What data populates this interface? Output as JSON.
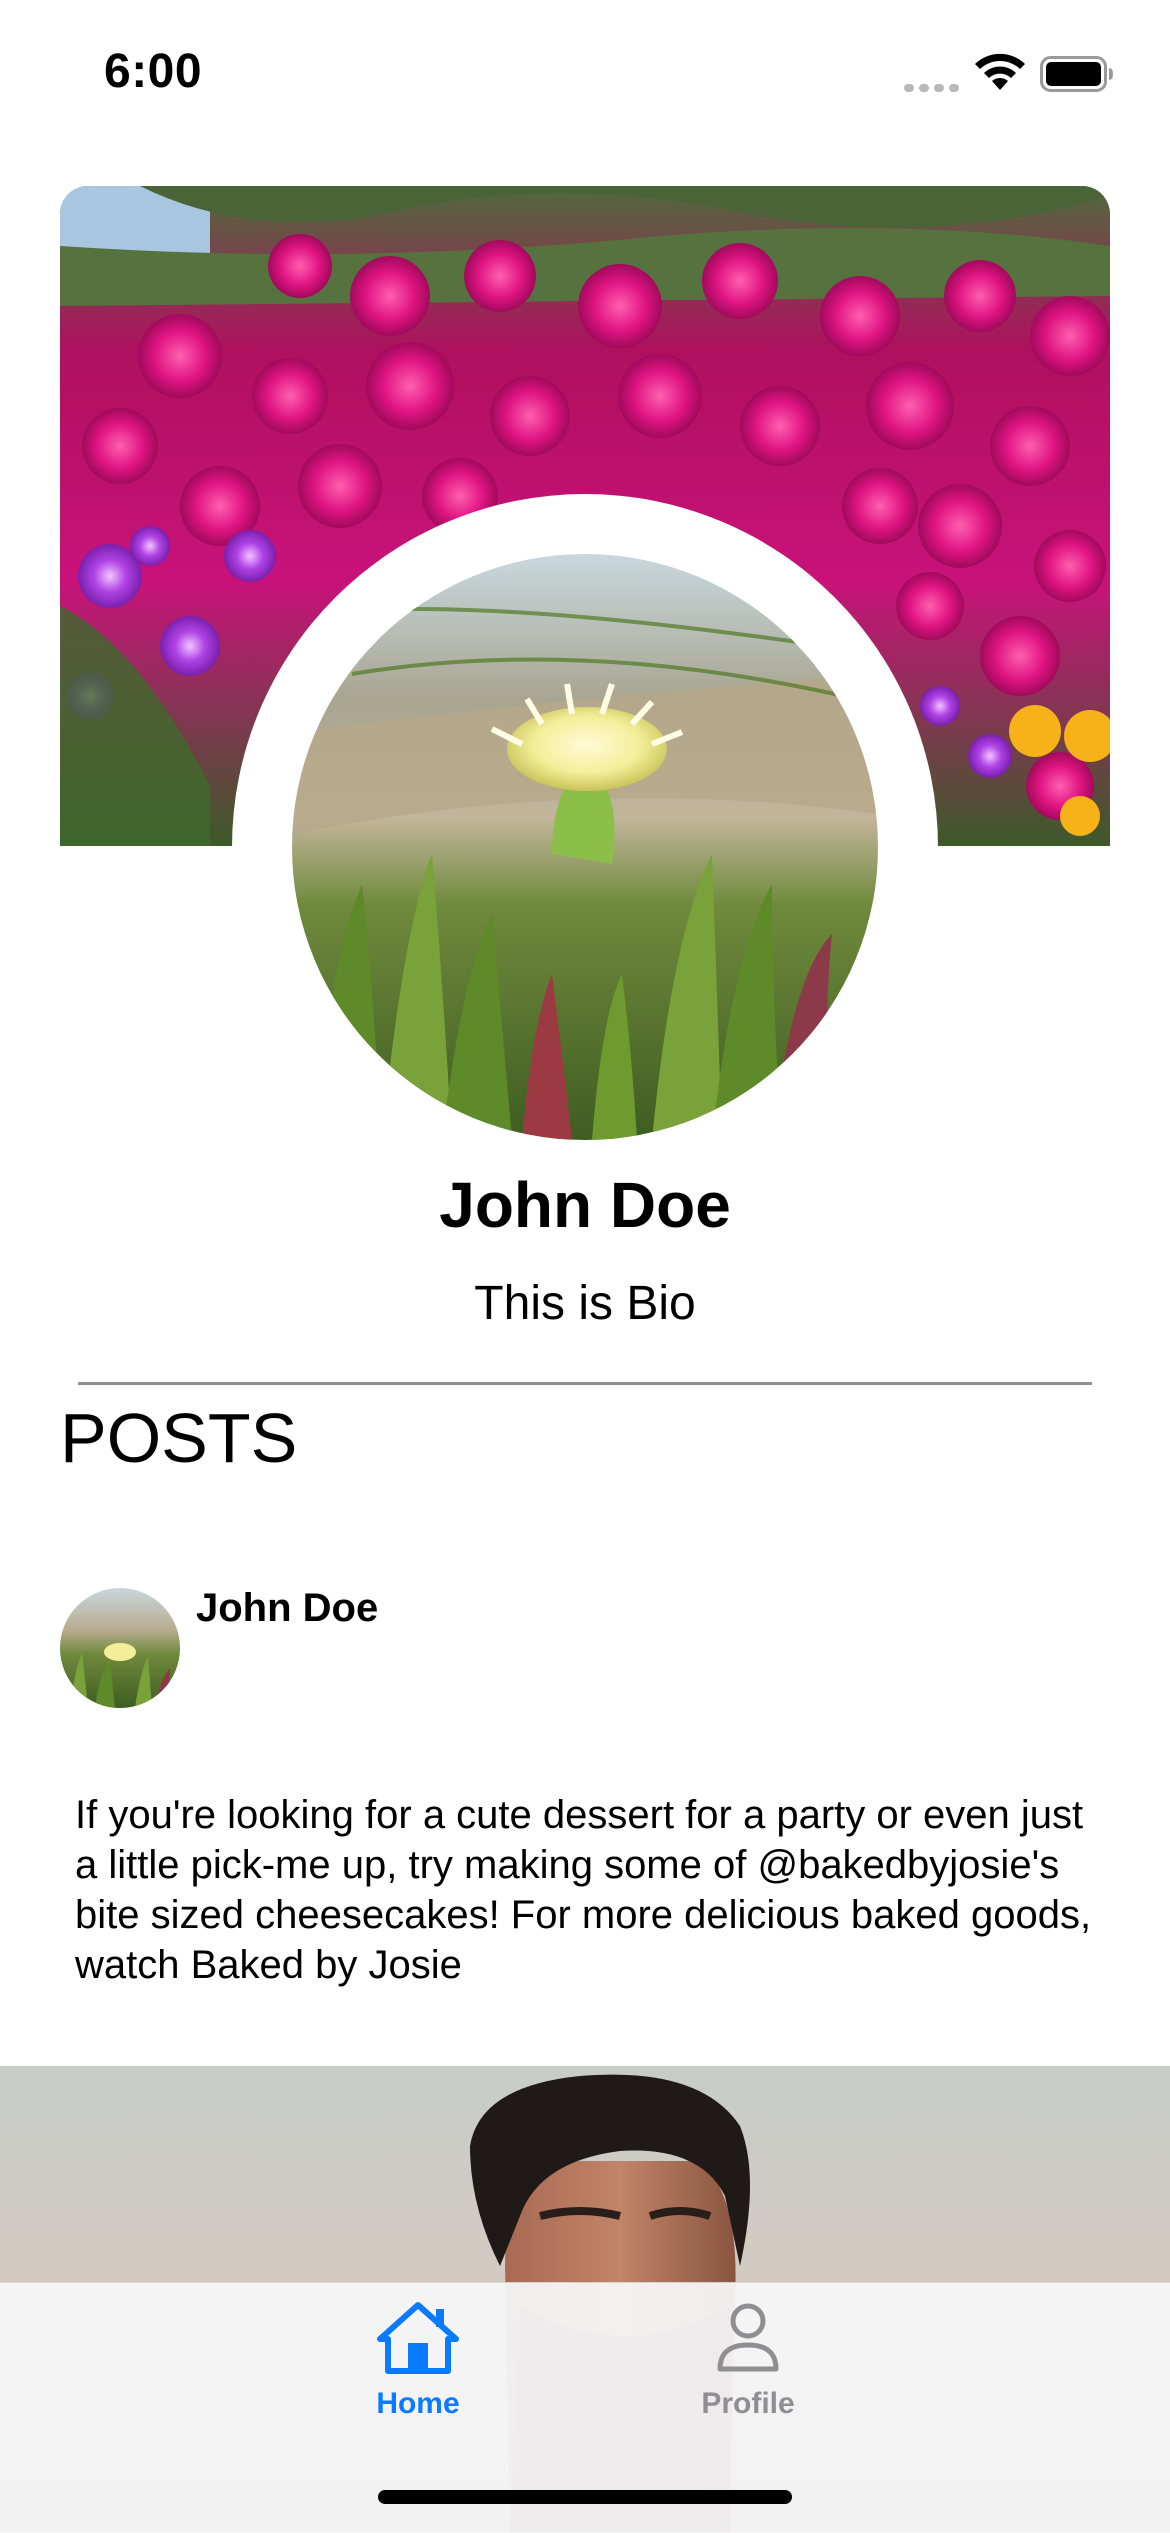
{
  "status_bar": {
    "time": "6:00",
    "icons": [
      "signal-dots-icon",
      "wifi-icon",
      "battery-icon"
    ]
  },
  "profile": {
    "cover_photo": "pink-ice-plant-flowers",
    "avatar_photo": "yellow-ice-plant-flower",
    "name": "John Doe",
    "bio": "This is Bio"
  },
  "posts_section": {
    "heading": "POSTS"
  },
  "posts": [
    {
      "author": "John Doe",
      "text": "If you're looking for a cute dessert for a party or even just a little pick-me up, try making some of @bakedbyjosie's bite sized cheesecakes! For more delicious baked goods, watch Baked by Josie",
      "image": "man-portrait"
    }
  ],
  "tab_bar": {
    "tabs": [
      {
        "label": "Home",
        "icon": "house-icon",
        "selected": true
      },
      {
        "label": "Profile",
        "icon": "person-icon",
        "selected": false
      }
    ],
    "accent_color": "#0a7aff",
    "inactive_color": "#8e8e93"
  }
}
